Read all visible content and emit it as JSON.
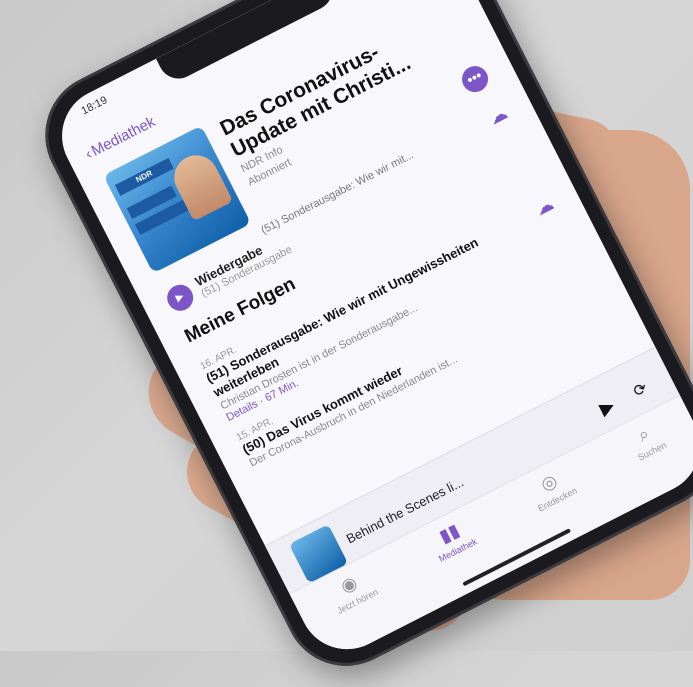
{
  "status": {
    "time": "18:19"
  },
  "nav": {
    "back_label": "Mediathek"
  },
  "podcast": {
    "title": "Das Coronavirus-Update mit Christi...",
    "author": "NDR Info",
    "meta": "Abonniert",
    "cover_text": "NDR Info · Coronavirus-Update"
  },
  "playback": {
    "label": "Wiedergabe",
    "sub": "(51) Sonderausgabe"
  },
  "description": "(51) Sonderausgabe: Wie wir mit...",
  "section_title": "Meine Folgen",
  "episodes": [
    {
      "date": "16. APR.",
      "title": "(51) Sonderausgabe: Wie wir mit Ungewissheiten weiterleben",
      "desc": "Christian Drosten ist in der Sonderausgabe...",
      "detail": "Details · 67 Min."
    },
    {
      "date": "15. APR.",
      "title": "(50) Das Virus kommt wieder",
      "desc": "Der Corona-Ausbruch in den Niederlanden ist...",
      "detail": ""
    }
  ],
  "mini_player": {
    "title": "Behind the Scenes li..."
  },
  "tabs": [
    {
      "label": "Jetzt hören",
      "icon": "play-circle-icon",
      "active": false
    },
    {
      "label": "Mediathek",
      "icon": "library-icon",
      "active": true
    },
    {
      "label": "Entdecken",
      "icon": "podcast-icon",
      "active": false
    },
    {
      "label": "Suchen",
      "icon": "search-icon",
      "active": false
    }
  ],
  "colors": {
    "accent": "#7c55c9",
    "background": "#f8f7fb"
  }
}
